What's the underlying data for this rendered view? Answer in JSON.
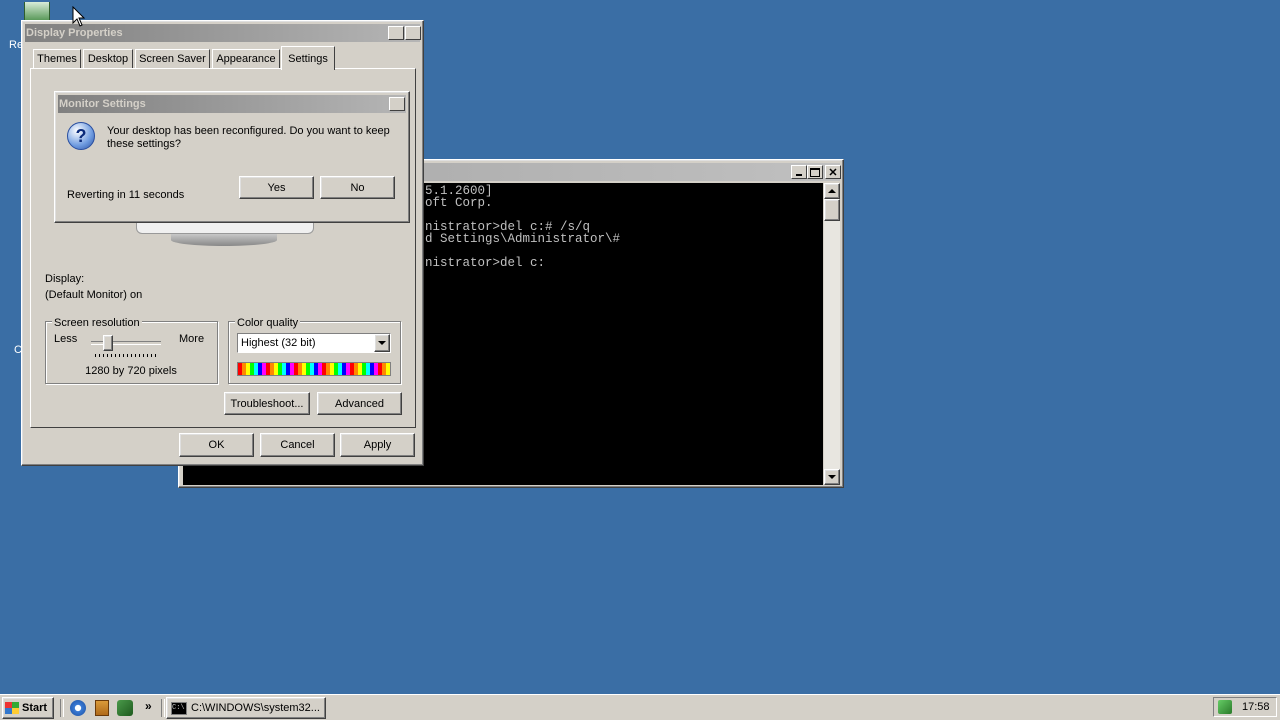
{
  "desktop": {
    "icon_label_fragment": "Re",
    "icon_label_fragment2": "C"
  },
  "console": {
    "lines": [
      "5.1.2600]",
      "oft Corp.",
      "",
      "nistrator>del c:# /s/q",
      "d Settings\\Administrator\\#",
      "",
      "nistrator>del c:"
    ]
  },
  "display_properties": {
    "title": "Display Properties",
    "help_glyph": "?",
    "close_glyph": "✕",
    "tabs": [
      "Themes",
      "Desktop",
      "Screen Saver",
      "Appearance",
      "Settings"
    ],
    "active_tab": "Settings",
    "display_label": "Display:",
    "display_value": "(Default Monitor) on",
    "screen_resolution": {
      "label": "Screen resolution",
      "less": "Less",
      "more": "More",
      "value_text": "1280 by 720 pixels",
      "slider_level": 0.2
    },
    "color_quality": {
      "label": "Color quality",
      "selected": "Highest (32 bit)"
    },
    "buttons": {
      "troubleshoot": "Troubleshoot...",
      "advanced": "Advanced",
      "ok": "OK",
      "cancel": "Cancel",
      "apply": "Apply"
    }
  },
  "monitor_settings": {
    "title": "Monitor Settings",
    "message_line1": "Your desktop has been reconfigured.  Do you want to keep",
    "message_line2": "these settings?",
    "countdown": "Reverting in 11 seconds",
    "yes": "Yes",
    "no": "No"
  },
  "taskbar": {
    "start_label": "Start",
    "chevron": "»",
    "task_label": "C:\\WINDOWS\\system32...",
    "clock": "17:58"
  }
}
